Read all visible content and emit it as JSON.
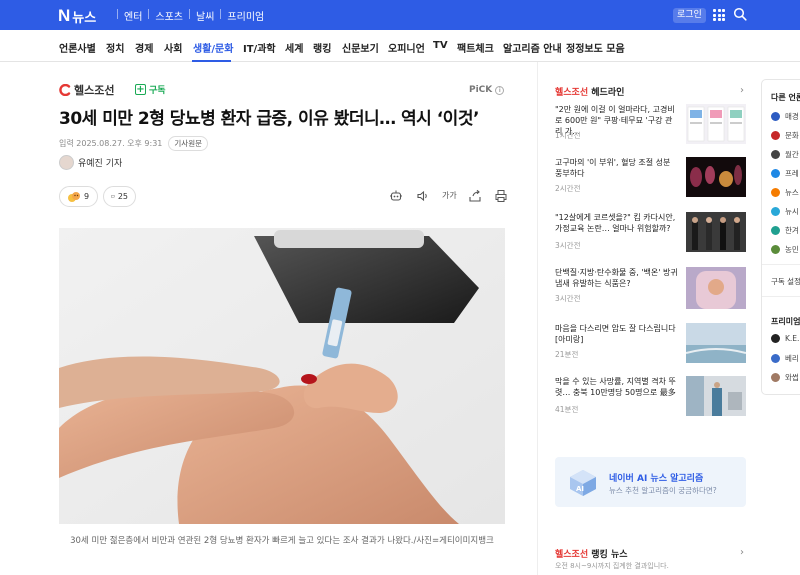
{
  "topbar": {
    "logo_n": "N",
    "logo_text": "뉴스",
    "nav": [
      "엔터",
      "스포츠",
      "날씨",
      "프리미엄"
    ],
    "login_label": "로그인"
  },
  "categories": [
    {
      "label": "언론사별",
      "active": false
    },
    {
      "label": "정치",
      "active": false
    },
    {
      "label": "경제",
      "active": false
    },
    {
      "label": "사회",
      "active": false
    },
    {
      "label": "생활/문화",
      "active": true
    },
    {
      "label": "IT/과학",
      "active": false
    },
    {
      "label": "세계",
      "active": false
    },
    {
      "label": "랭킹",
      "active": false
    },
    {
      "label": "신문보기",
      "active": false
    },
    {
      "label": "오피니언",
      "active": false
    },
    {
      "label": "TV",
      "active": false
    },
    {
      "label": "팩트체크",
      "active": false
    },
    {
      "label": "알고리즘 안내",
      "active": false
    },
    {
      "label": "정정보도 모음",
      "active": false
    }
  ],
  "article": {
    "press": "헬스조선",
    "subscribe_label": "구독",
    "pick_label": "PiCK",
    "headline": "30세 미만 2형 당뇨병 환자 급증, 이유 봤더니… 역시 ‘이것’",
    "date": "입력 2025.08.27. 오후 9:31",
    "original_label": "기사원문",
    "reporter": "유예진 기자",
    "reactions_count": "9",
    "comments_count": "25",
    "font_size_label": "가가",
    "caption": "30세 미만 젊은층에서 비만과 연관된 2형 당뇨병 환자가 빠르게 늘고 있다는 조사 결과가 나왔다./사진=게티이미지뱅크"
  },
  "headlines": {
    "press": "헬스조선",
    "title": "헤드라인",
    "items": [
      {
        "text": "\"2만 원에 이걸 이 얼마라다, 고경비로 600만 원\" 쿠팡·테무묘 '구강 관리 가…",
        "time": "1시간전"
      },
      {
        "text": "고구마의 '이 부위', 혈당 조절 성분 풍부하다",
        "time": "2시간전"
      },
      {
        "text": "\"12살에게 코르셋을?\" 킴 카다시안, 가정교육 논란… 얼마나 위험할까?",
        "time": "3시간전"
      },
      {
        "text": "단백질·지방·탄수화물 중, '백온' 방귀 냄새 유발하는 식품은?",
        "time": "3시간전"
      },
      {
        "text": "마음을 다스리면 암도 잘 다스립니다 [아미랑]",
        "time": "21분전"
      },
      {
        "text": "막을 수 있는 사망률, 지역별 격차 뚜렷… 충북 10만명당 50명으로 最多",
        "time": "41분전"
      }
    ]
  },
  "ai_card": {
    "title": "네이버 AI 뉴스 알고리즘",
    "subtitle": "뉴스 추천 알고리즘이 궁금하다면?"
  },
  "ranking": {
    "press": "헬스조선",
    "title": "랭킹 뉴스",
    "subtitle": "오전 8시~9시까지 집계한 결과입니다."
  },
  "far_panel": {
    "title1": "다른 언론사",
    "presses": [
      "매경",
      "문화",
      "월간",
      "프레",
      "뉴스",
      "뉴시",
      "한겨",
      "농민"
    ],
    "subscribe_settings": "구독 설정",
    "title2": "프리미엄",
    "premium": [
      "K.E.",
      "베리",
      "와썹"
    ]
  },
  "colors": {
    "brand": "#2e5ce5",
    "press": "#e53935",
    "subscribe": "#1aaa55"
  }
}
